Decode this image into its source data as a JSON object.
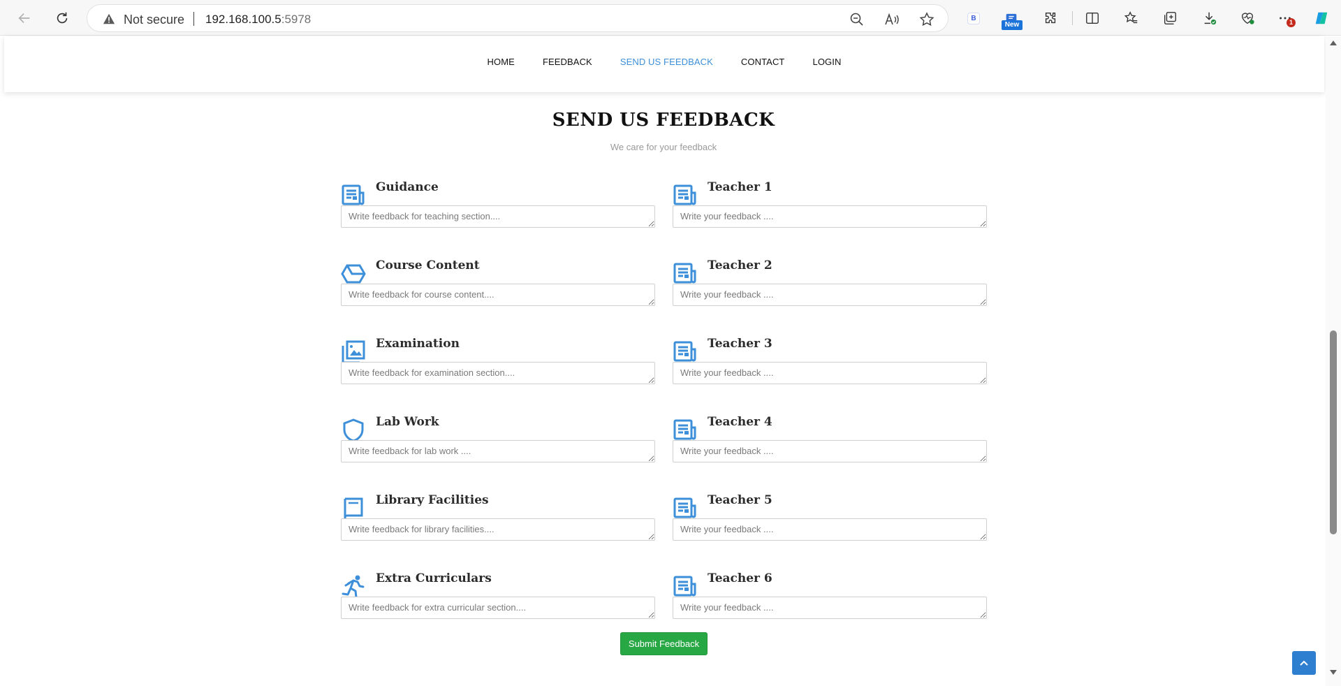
{
  "browser": {
    "not_secure_label": "Not secure",
    "url_host": "192.168.100.5",
    "url_port": ":5978",
    "ext_b_label": "B",
    "new_badge": "New",
    "more_badge_count": "1"
  },
  "nav": {
    "items": [
      {
        "label": "HOME",
        "active": false
      },
      {
        "label": "FEEDBACK",
        "active": false
      },
      {
        "label": "SEND US FEEDBACK",
        "active": true
      },
      {
        "label": "CONTACT",
        "active": false
      },
      {
        "label": "LOGIN",
        "active": false
      }
    ],
    "active_color": "#3d8fd9"
  },
  "main": {
    "title": "SEND US FEEDBACK",
    "subtitle": "We care for your feedback",
    "icon_color": "#3d8fd9",
    "left_fields": [
      {
        "icon": "newspaper-icon",
        "title": "Guidance",
        "placeholder": "Write feedback for teaching section....",
        "value": ""
      },
      {
        "icon": "cube-icon",
        "title": "Course Content",
        "placeholder": "Write feedback for course content....",
        "value": ""
      },
      {
        "icon": "images-icon",
        "title": "Examination",
        "placeholder": "Write feedback for examination section....",
        "value": ""
      },
      {
        "icon": "shield-icon",
        "title": "Lab Work",
        "placeholder": "Write feedback for lab work ....",
        "value": ""
      },
      {
        "icon": "book-icon",
        "title": "Library Facilities",
        "placeholder": "Write feedback for library facilities....",
        "value": ""
      },
      {
        "icon": "running-person-icon",
        "title": "Extra Curriculars",
        "placeholder": "Write feedback for extra curricular section....",
        "value": ""
      }
    ],
    "right_fields": [
      {
        "icon": "newspaper-icon",
        "title": "Teacher 1",
        "placeholder": "Write your feedback ....",
        "value": ""
      },
      {
        "icon": "newspaper-icon",
        "title": "Teacher 2",
        "placeholder": "Write your feedback ....",
        "value": ""
      },
      {
        "icon": "newspaper-icon",
        "title": "Teacher 3",
        "placeholder": "Write your feedback ....",
        "value": ""
      },
      {
        "icon": "newspaper-icon",
        "title": "Teacher 4",
        "placeholder": "Write your feedback ....",
        "value": ""
      },
      {
        "icon": "newspaper-icon",
        "title": "Teacher 5",
        "placeholder": "Write your feedback ....",
        "value": ""
      },
      {
        "icon": "newspaper-icon",
        "title": "Teacher 6",
        "placeholder": "Write your feedback ....",
        "value": ""
      }
    ],
    "submit_label": "Submit Feedback",
    "submit_color": "#28a745"
  },
  "back_to_top": {
    "icon": "chevron-up-icon",
    "color": "#2f7fd1"
  }
}
